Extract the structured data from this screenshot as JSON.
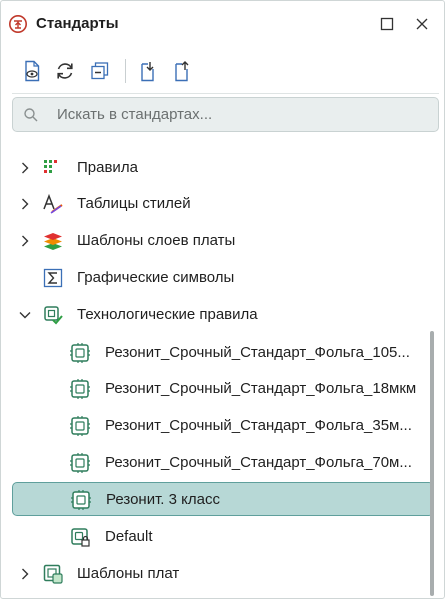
{
  "window": {
    "title": "Стандарты"
  },
  "search": {
    "placeholder": "Искать в стандартах..."
  },
  "tree": {
    "items": [
      {
        "label": "Правила"
      },
      {
        "label": "Таблицы стилей"
      },
      {
        "label": "Шаблоны слоев платы"
      },
      {
        "label": "Графические символы"
      },
      {
        "label": "Технологические правила"
      },
      {
        "label": "Резонит_Срочный_Стандарт_Фольга_105..."
      },
      {
        "label": "Резонит_Срочный_Стандарт_Фольга_18мкм"
      },
      {
        "label": "Резонит_Срочный_Стандарт_Фольга_35м..."
      },
      {
        "label": "Резонит_Срочный_Стандарт_Фольга_70м..."
      },
      {
        "label": "Резонит. 3 класс"
      },
      {
        "label": "Default"
      },
      {
        "label": "Шаблоны плат"
      }
    ]
  },
  "colors": {
    "accent": "#2f7d5c",
    "selected_bg": "#b7d8d6",
    "selected_border": "#5f9f9c",
    "toolbar_icon": "#3b6fb6"
  }
}
